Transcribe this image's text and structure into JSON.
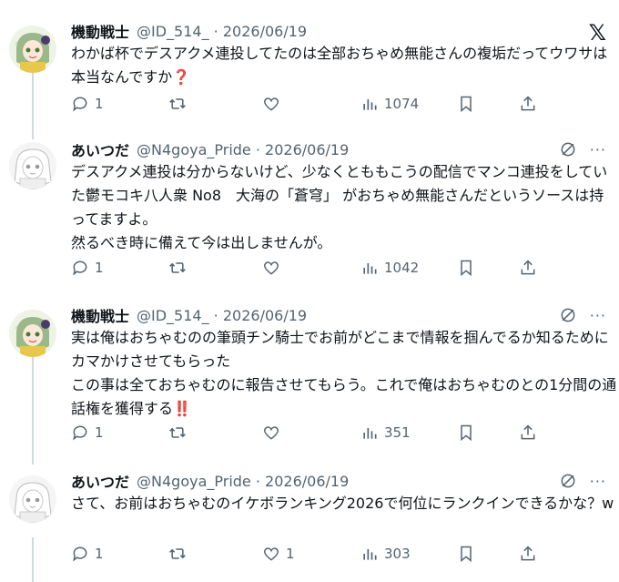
{
  "x_logo": "𝕏",
  "more": "···",
  "tweets": [
    {
      "name": "機動戦士",
      "meta": "@ID_514_ · 2026/06/19",
      "text": "わかば杯でデスアクメ連投してたのは全部おちゃめ無能さんの複垢だってウワサは本当なんですか❓",
      "replies": "1",
      "retweets": "",
      "likes": "",
      "views": "1074"
    },
    {
      "name": "あいつだ",
      "meta": "@N4goya_Pride · 2026/06/19",
      "text": "デスアクメ連投は分からないけど、少なくとももこうの配信でマンコ連投をしていた鬱モコキ八人衆 No8　大海の「蒼穹」 がおちゃめ無能さんだというソースは持ってますよ。\n然るべき時に備えて今は出しませんが。",
      "replies": "1",
      "retweets": "",
      "likes": "",
      "views": "1042"
    },
    {
      "name": "機動戦士",
      "meta": "@ID_514_ · 2026/06/19",
      "text": "実は俺はおちゃむのの筆頭チン騎士でお前がどこまで情報を掴んでるか知るためにカマかけさせてもらった\nこの事は全ておちゃむのに報告させてもらう。これで俺はおちゃむのとの1分間の通話権を獲得する‼️",
      "replies": "1",
      "retweets": "",
      "likes": "",
      "views": "351"
    },
    {
      "name": "あいつだ",
      "meta": "@N4goya_Pride · 2026/06/19",
      "text": "さて、お前はおちゃむのイケボランキング2026で何位にランクインできるかな？w",
      "replies": "1",
      "retweets": "",
      "likes": "1",
      "views": "303"
    }
  ],
  "colors": {
    "text": "#0f1419",
    "secondary": "#536471",
    "thread": "#cfd9de"
  }
}
